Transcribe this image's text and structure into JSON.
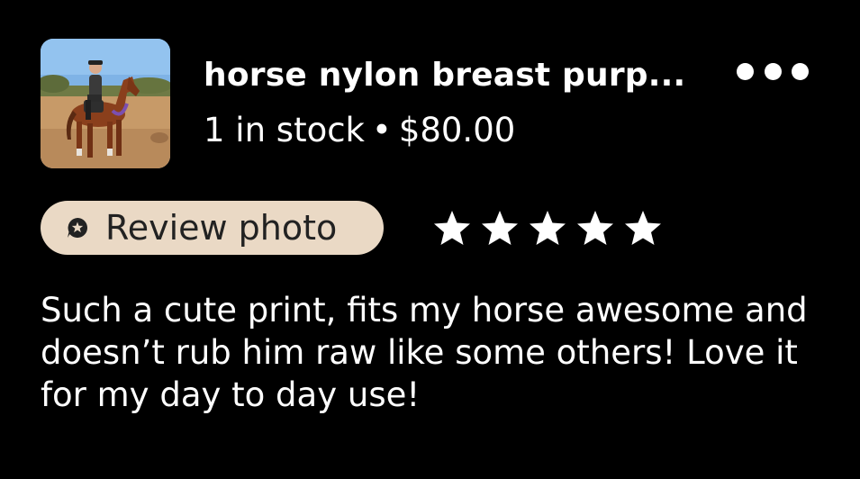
{
  "listing": {
    "title": "horse nylon breast purp...",
    "stock": "1 in stock",
    "separator": "•",
    "price": "$80.00",
    "thumbnail_icon": "horse-rider-photo"
  },
  "actions": {
    "more_icon": "more-horizontal-icon"
  },
  "badge": {
    "label": "Review photo",
    "icon": "star-chat-icon",
    "background": "#ead9c5"
  },
  "rating": {
    "value": 5,
    "max": 5,
    "color": "#ffffff"
  },
  "review": {
    "text": "Such a cute print, fits my horse awesome and doesn’t rub him raw like some others! Love it for my day to day use!"
  }
}
